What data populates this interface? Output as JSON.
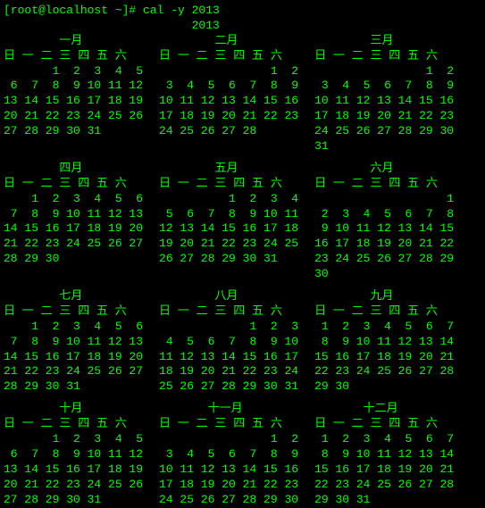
{
  "prompt": "[root@localhost ~]# cal -y 2013",
  "yearLine": "                           2013",
  "months": [
    {
      "title": "        一月",
      "weekdays": "日 一 二 三 四 五 六",
      "weeks": [
        "       1  2  3  4  5",
        " 6  7  8  9 10 11 12",
        "13 14 15 16 17 18 19",
        "20 21 22 23 24 25 26",
        "27 28 29 30 31"
      ]
    },
    {
      "title": "        二月",
      "weekdays": "日 一 二 三 四 五 六",
      "weeks": [
        "                1  2",
        " 3  4  5  6  7  8  9",
        "10 11 12 13 14 15 16",
        "17 18 19 20 21 22 23",
        "24 25 26 27 28"
      ]
    },
    {
      "title": "        三月",
      "weekdays": "日 一 二 三 四 五 六",
      "weeks": [
        "                1  2",
        " 3  4  5  6  7  8  9",
        "10 11 12 13 14 15 16",
        "17 18 19 20 21 22 23",
        "24 25 26 27 28 29 30",
        "31"
      ]
    },
    {
      "title": "        四月",
      "weekdays": "日 一 二 三 四 五 六",
      "weeks": [
        "    1  2  3  4  5  6",
        " 7  8  9 10 11 12 13",
        "14 15 16 17 18 19 20",
        "21 22 23 24 25 26 27",
        "28 29 30"
      ]
    },
    {
      "title": "        五月",
      "weekdays": "日 一 二 三 四 五 六",
      "weeks": [
        "          1  2  3  4",
        " 5  6  7  8  9 10 11",
        "12 13 14 15 16 17 18",
        "19 20 21 22 23 24 25",
        "26 27 28 29 30 31"
      ]
    },
    {
      "title": "        六月",
      "weekdays": "日 一 二 三 四 五 六",
      "weeks": [
        "                   1",
        " 2  3  4  5  6  7  8",
        " 9 10 11 12 13 14 15",
        "16 17 18 19 20 21 22",
        "23 24 25 26 27 28 29",
        "30"
      ]
    },
    {
      "title": "        七月",
      "weekdays": "日 一 二 三 四 五 六",
      "weeks": [
        "    1  2  3  4  5  6",
        " 7  8  9 10 11 12 13",
        "14 15 16 17 18 19 20",
        "21 22 23 24 25 26 27",
        "28 29 30 31"
      ]
    },
    {
      "title": "        八月",
      "weekdays": "日 一 二 三 四 五 六",
      "weeks": [
        "             1  2  3",
        " 4  5  6  7  8  9 10",
        "11 12 13 14 15 16 17",
        "18 19 20 21 22 23 24",
        "25 26 27 28 29 30 31"
      ]
    },
    {
      "title": "        九月",
      "weekdays": "日 一 二 三 四 五 六",
      "weeks": [
        " 1  2  3  4  5  6  7",
        " 8  9 10 11 12 13 14",
        "15 16 17 18 19 20 21",
        "22 23 24 25 26 27 28",
        "29 30"
      ]
    },
    {
      "title": "        十月",
      "weekdays": "日 一 二 三 四 五 六",
      "weeks": [
        "       1  2  3  4  5",
        " 6  7  8  9 10 11 12",
        "13 14 15 16 17 18 19",
        "20 21 22 23 24 25 26",
        "27 28 29 30 31"
      ]
    },
    {
      "title": "       十一月",
      "weekdays": "日 一 二 三 四 五 六",
      "weeks": [
        "                1  2",
        " 3  4  5  6  7  8  9",
        "10 11 12 13 14 15 16",
        "17 18 19 20 21 22 23",
        "24 25 26 27 28 29 30"
      ]
    },
    {
      "title": "       十二月",
      "weekdays": "日 一 二 三 四 五 六",
      "weeks": [
        " 1  2  3  4  5  6  7",
        " 8  9 10 11 12 13 14",
        "15 16 17 18 19 20 21",
        "22 23 24 25 26 27 28",
        "29 30 31"
      ]
    }
  ]
}
